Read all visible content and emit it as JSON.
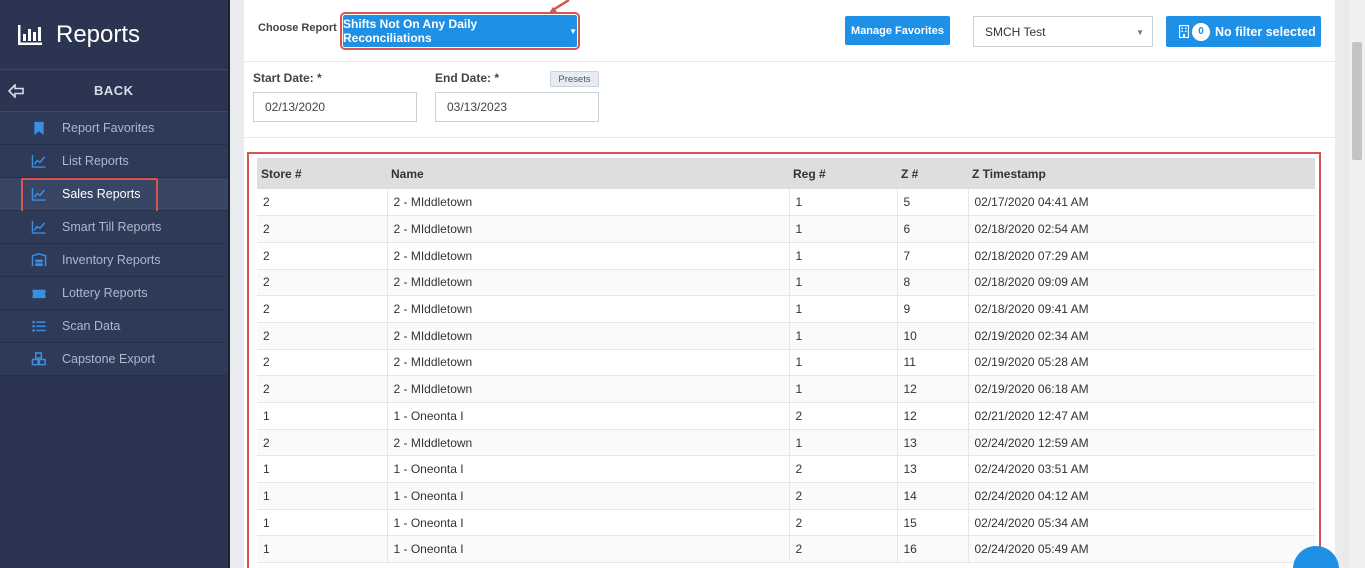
{
  "sidebar": {
    "title": "Reports",
    "back": "BACK",
    "items": [
      {
        "label": "Report Favorites",
        "icon": "bookmark-icon",
        "active": false
      },
      {
        "label": "List Reports",
        "icon": "chart-line-icon",
        "active": false
      },
      {
        "label": "Sales Reports",
        "icon": "chart-line-icon",
        "active": true
      },
      {
        "label": "Smart Till Reports",
        "icon": "chart-line-icon",
        "active": false
      },
      {
        "label": "Inventory Reports",
        "icon": "warehouse-icon",
        "active": false
      },
      {
        "label": "Lottery Reports",
        "icon": "ticket-icon",
        "active": false
      },
      {
        "label": "Scan Data",
        "icon": "list-icon",
        "active": false
      },
      {
        "label": "Capstone Export",
        "icon": "boxes-icon",
        "active": false
      }
    ]
  },
  "toolbar": {
    "choose_label": "Choose Report",
    "report_selected": "Shifts Not On Any Daily Reconciliations",
    "manage_favorites": "Manage Favorites",
    "store_selected": "SMCH Test",
    "filter_count": "0",
    "filter_label": "No filter selected"
  },
  "dates": {
    "start_label": "Start Date: *",
    "start_value": "02/13/2020",
    "end_label": "End Date: *",
    "end_value": "03/13/2023",
    "presets": "Presets"
  },
  "table": {
    "headers": [
      "Store #",
      "Name",
      "Reg #",
      "Z #",
      "Z Timestamp"
    ],
    "rows": [
      [
        "2",
        "2 - MIddletown",
        "1",
        "5",
        "02/17/2020 04:41 AM"
      ],
      [
        "2",
        "2 - MIddletown",
        "1",
        "6",
        "02/18/2020 02:54 AM"
      ],
      [
        "2",
        "2 - MIddletown",
        "1",
        "7",
        "02/18/2020 07:29 AM"
      ],
      [
        "2",
        "2 - MIddletown",
        "1",
        "8",
        "02/18/2020 09:09 AM"
      ],
      [
        "2",
        "2 - MIddletown",
        "1",
        "9",
        "02/18/2020 09:41 AM"
      ],
      [
        "2",
        "2 - MIddletown",
        "1",
        "10",
        "02/19/2020 02:34 AM"
      ],
      [
        "2",
        "2 - MIddletown",
        "1",
        "11",
        "02/19/2020 05:28 AM"
      ],
      [
        "2",
        "2 - MIddletown",
        "1",
        "12",
        "02/19/2020 06:18 AM"
      ],
      [
        "1",
        "1 - Oneonta I",
        "2",
        "12",
        "02/21/2020 12:47 AM"
      ],
      [
        "2",
        "2 - MIddletown",
        "1",
        "13",
        "02/24/2020 12:59 AM"
      ],
      [
        "1",
        "1 - Oneonta I",
        "2",
        "13",
        "02/24/2020 03:51 AM"
      ],
      [
        "1",
        "1 - Oneonta I",
        "2",
        "14",
        "02/24/2020 04:12 AM"
      ],
      [
        "1",
        "1 - Oneonta I",
        "2",
        "15",
        "02/24/2020 05:34 AM"
      ],
      [
        "1",
        "1 - Oneonta I",
        "2",
        "16",
        "02/24/2020 05:49 AM"
      ]
    ]
  },
  "colors": {
    "sidebar_bg": "#2b3552",
    "accent": "#1e90e6",
    "highlight": "#d9534f"
  }
}
